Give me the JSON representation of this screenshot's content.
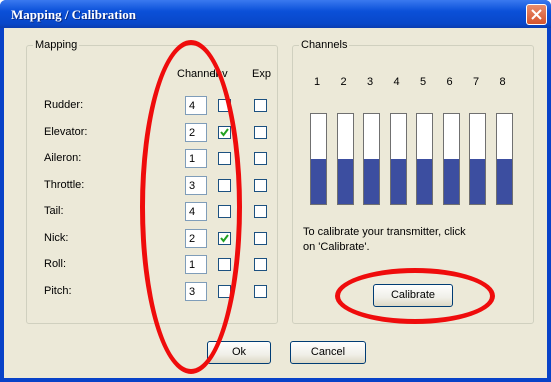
{
  "window": {
    "title": "Mapping / Calibration"
  },
  "mapping": {
    "group_label": "Mapping",
    "headers": {
      "channel": "Channel",
      "inv": "Inv",
      "exp": "Exp"
    },
    "rows": [
      {
        "label": "Rudder:",
        "channel": "4",
        "inv": false,
        "exp": false
      },
      {
        "label": "Elevator:",
        "channel": "2",
        "inv": true,
        "exp": false
      },
      {
        "label": "Aileron:",
        "channel": "1",
        "inv": false,
        "exp": false
      },
      {
        "label": "Throttle:",
        "channel": "3",
        "inv": false,
        "exp": false
      },
      {
        "label": "Tail:",
        "channel": "4",
        "inv": false,
        "exp": false
      },
      {
        "label": "Nick:",
        "channel": "2",
        "inv": true,
        "exp": false
      },
      {
        "label": "Roll:",
        "channel": "1",
        "inv": false,
        "exp": false
      },
      {
        "label": "Pitch:",
        "channel": "3",
        "inv": false,
        "exp": false
      }
    ]
  },
  "channels": {
    "group_label": "Channels",
    "numbers": [
      "1",
      "2",
      "3",
      "4",
      "5",
      "6",
      "7",
      "8"
    ],
    "levels": [
      0.5,
      0.5,
      0.5,
      0.5,
      0.5,
      0.5,
      0.5,
      0.5
    ],
    "instruction_line1": "To calibrate your transmitter, click",
    "instruction_line2": "on 'Calibrate'.",
    "calibrate_label": "Calibrate"
  },
  "buttons": {
    "ok": "Ok",
    "cancel": "Cancel"
  },
  "colors": {
    "bar_fill": "#3c4ea0",
    "highlight_oval": "#ef0c0c",
    "title_bar": "#0b50d8"
  },
  "icons": {
    "close": "close-icon",
    "check": "checkmark-icon"
  }
}
